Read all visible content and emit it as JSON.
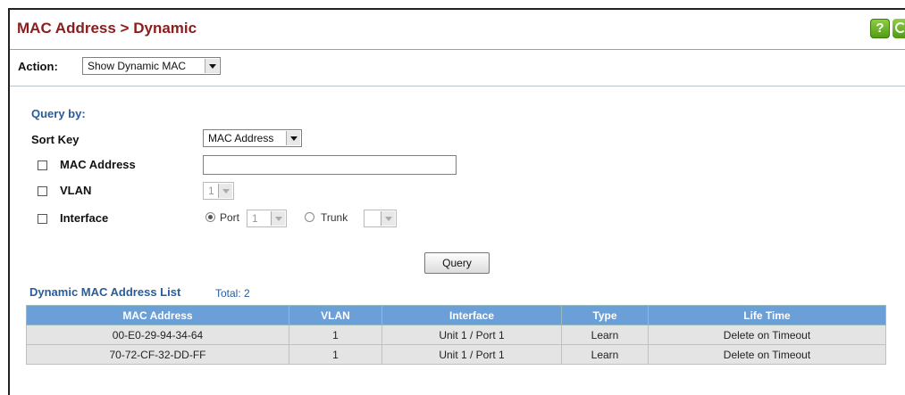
{
  "header": {
    "title": "MAC Address > Dynamic",
    "help_icon": "?"
  },
  "action": {
    "label": "Action:",
    "value": "Show Dynamic MAC"
  },
  "query": {
    "heading": "Query by:",
    "sort_key_label": "Sort Key",
    "sort_key_value": "MAC Address",
    "mac_label": "MAC Address",
    "mac_value": "",
    "vlan_label": "VLAN",
    "vlan_value": "1",
    "interface_label": "Interface",
    "port_label": "Port",
    "port_value": "1",
    "trunk_label": "Trunk",
    "trunk_value": "",
    "query_button": "Query"
  },
  "list": {
    "title": "Dynamic MAC Address List",
    "total": "Total: 2",
    "columns": [
      "MAC Address",
      "VLAN",
      "Interface",
      "Type",
      "Life Time"
    ],
    "rows": [
      [
        "00-E0-29-94-34-64",
        "1",
        "Unit 1 / Port 1",
        "Learn",
        "Delete on Timeout"
      ],
      [
        "70-72-CF-32-DD-FF",
        "1",
        "Unit 1 / Port 1",
        "Learn",
        "Delete on Timeout"
      ]
    ]
  }
}
